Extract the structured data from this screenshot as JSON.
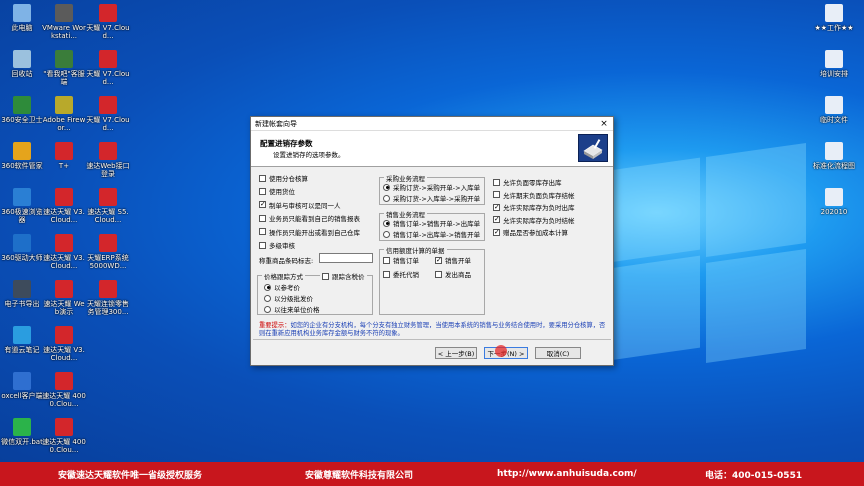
{
  "desktop": {
    "left_icons": [
      {
        "label": "此电脑",
        "icon": "computer-icon",
        "color": "#7fb3e6"
      },
      {
        "label": "回收站",
        "icon": "recycle-bin-icon",
        "color": "#9bc1de"
      },
      {
        "label": "360安全卫士",
        "icon": "shield-360-icon",
        "color": "#2e8b3a"
      },
      {
        "label": "360软件管家",
        "icon": "softmanager-360-icon",
        "color": "#e5a41c"
      },
      {
        "label": "360极速浏览器",
        "icon": "browser-360-icon",
        "color": "#2a7fd4"
      },
      {
        "label": "360驱动大师",
        "icon": "driver-360-icon",
        "color": "#1e6fc9"
      },
      {
        "label": "电子书导出",
        "icon": "ebook-icon",
        "color": "#3d4b5c"
      },
      {
        "label": "有道云笔记",
        "icon": "youdao-note-icon",
        "color": "#2a9de0"
      },
      {
        "label": "oxcell客户端",
        "icon": "oxcell-icon",
        "color": "#2f6fd0"
      },
      {
        "label": "微信双开.bat",
        "icon": "wechat-icon",
        "color": "#2bb34a"
      }
    ],
    "col2_icons": [
      {
        "label": "VMware Workstati...",
        "icon": "vmware-icon",
        "color": "#5b5b5b"
      },
      {
        "label": "\"看我吧\"客服端",
        "icon": "kanwoba-icon",
        "color": "#3a7d3a"
      },
      {
        "label": "Adobe Firewor...",
        "icon": "fireworks-icon",
        "color": "#b8a92b"
      },
      {
        "label": "T+",
        "icon": "tplus-icon",
        "color": "#d3262b"
      },
      {
        "label": "速达天耀 V3.Cloud...",
        "icon": "suda-icon",
        "color": "#d3262b"
      },
      {
        "label": "速达天耀 V3.Cloud...",
        "icon": "suda-icon",
        "color": "#d3262b"
      },
      {
        "label": "速达天耀 Web演示",
        "icon": "suda-icon",
        "color": "#d3262b"
      },
      {
        "label": "速达天耀 V3.Cloud...",
        "icon": "suda-icon",
        "color": "#d3262b"
      },
      {
        "label": "速达天耀 4000.Clou...",
        "icon": "suda-icon",
        "color": "#d3262b"
      },
      {
        "label": "速达天耀 4000.Clou...",
        "icon": "suda-icon",
        "color": "#d3262b"
      }
    ],
    "col3_icons": [
      {
        "label": "天耀 V7.Cloud...",
        "icon": "suda-icon",
        "color": "#d3262b"
      },
      {
        "label": "天耀 V7.Cloud...",
        "icon": "suda-icon",
        "color": "#d3262b"
      },
      {
        "label": "天耀 V7.Cloud...",
        "icon": "suda-icon",
        "color": "#d3262b"
      },
      {
        "label": "速达Web接口登录",
        "icon": "suda-icon",
        "color": "#d3262b"
      },
      {
        "label": "速达天耀 S5.Cloud...",
        "icon": "suda-icon",
        "color": "#d3262b"
      },
      {
        "label": "天耀ERP系统 5000WD...",
        "icon": "suda-icon",
        "color": "#d3262b"
      },
      {
        "label": "天耀连锁零售 务管理300...",
        "icon": "suda-icon",
        "color": "#d3262b"
      }
    ],
    "right_icons": [
      {
        "label": "★★工作★★",
        "icon": "work-folder-icon",
        "color": "#e8eef7"
      },
      {
        "label": "培训安排",
        "icon": "training-doc-icon",
        "color": "#e8eef7"
      },
      {
        "label": "临时文件",
        "icon": "temp-folder-icon",
        "color": "#e8eef7"
      },
      {
        "label": "标准化流程图",
        "icon": "flowchart-doc-icon",
        "color": "#e8eef7"
      },
      {
        "label": "202010",
        "icon": "folder-202010-icon",
        "color": "#e8eef7"
      }
    ]
  },
  "banner": {
    "text1": "安徽速达天耀软件唯一省级授权服务",
    "text2": "安徽尊耀软件科技有限公司",
    "text3": "http://www.anhuisuda.com/",
    "text4": "电话：400-015-0551",
    "color": "#c8161d"
  },
  "dialog": {
    "title": "新建帐套向导",
    "close": "×",
    "heading": "配置进销存参数",
    "subheading": "设置进销存的选项参数。",
    "left_options": [
      {
        "label": "使用分仓核算",
        "checked": false
      },
      {
        "label": "使用货位",
        "checked": false
      },
      {
        "label": "制单与审核可以是同一人",
        "checked": true
      },
      {
        "label": "业务员只能看到自己的销售报表",
        "checked": false
      },
      {
        "label": "操作员只能开出或看到自己仓库",
        "checked": false
      },
      {
        "label": "多级审核",
        "checked": false
      }
    ],
    "barcode_label": "称重商品条码标志:",
    "price_group": {
      "legend": "价格跟踪方式",
      "track_tax": "跟踪含税价",
      "options": [
        {
          "label": "以参考价",
          "checked": true
        },
        {
          "label": "以分级批发价",
          "checked": false
        },
        {
          "label": "以往来单位价格",
          "checked": false
        }
      ]
    },
    "purchase_group": {
      "legend": "采购业务流程",
      "options": [
        {
          "label": "采购订货->采购开单->入库单",
          "checked": true
        },
        {
          "label": "采购订货->入库单->采购开单",
          "checked": false
        }
      ]
    },
    "sales_group": {
      "legend": "销售业务流程",
      "options": [
        {
          "label": "销售订单->销售开单->出库单",
          "checked": true
        },
        {
          "label": "销售订单->出库单->销售开单",
          "checked": false
        }
      ]
    },
    "credit_group": {
      "legend": "信用额度计算的单据",
      "options": [
        {
          "label": "销售订单",
          "checked": false
        },
        {
          "label": "销售开单",
          "checked": true
        },
        {
          "label": "委托代销",
          "checked": false
        },
        {
          "label": "发出商品",
          "checked": false
        }
      ]
    },
    "right_options": [
      {
        "label": "允许负面零库存出库",
        "checked": false
      },
      {
        "label": "允许期末负面负库存结帐",
        "checked": false
      },
      {
        "label": "允许实际库存为负时出库",
        "checked": true
      },
      {
        "label": "允许实际库存为负时结帐",
        "checked": true
      },
      {
        "label": "赠品是否参加成本计算",
        "checked": true
      }
    ],
    "tip_label": "重要提示：",
    "tip_text": "如您的企业有分支机构，每个分支有独立财务管理，当使用本系统的销售与业务结合使用时，要采用分仓核算，否则在重新应用机构业务库存金额与财务不符的现象。",
    "buttons": {
      "prev": "< 上一步(B)",
      "next": "下一步(N) >",
      "cancel": "取消(C)"
    }
  }
}
